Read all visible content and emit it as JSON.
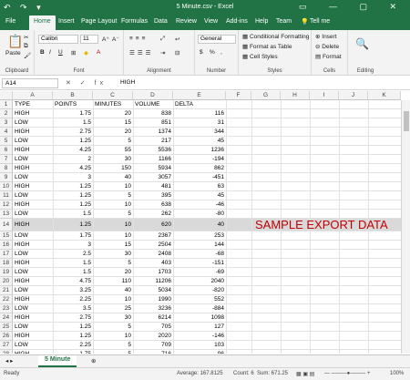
{
  "window": {
    "title": "5 Minute.csv - Excel",
    "quick_access": "↶ ↷ ▾",
    "controls": "▭ — ▢ ✕"
  },
  "tabs": [
    "File",
    "Home",
    "Insert",
    "Page Layout",
    "Formulas",
    "Data",
    "Review",
    "View",
    "Add-ins",
    "Help",
    "Team",
    "Tell me"
  ],
  "ribbon": {
    "clipboard": {
      "label": "Clipboard",
      "paste": "Paste"
    },
    "font": {
      "label": "Font",
      "name": "Calibri",
      "size": "11",
      "grow": "A⁺",
      "shrink": "A⁻",
      "bold": "B",
      "italic": "I",
      "underline": "U"
    },
    "alignment": {
      "label": "Alignment"
    },
    "number": {
      "label": "Number",
      "format": "General",
      "currency": "$",
      "percent": "%",
      "comma": ","
    },
    "styles": {
      "label": "Styles",
      "conditional": "Conditional Formatting",
      "table": "Format as Table",
      "cellstyles": "Cell Styles"
    },
    "cells": {
      "label": "Cells",
      "insert": "Insert",
      "delete": "Delete",
      "format": "Format"
    },
    "editing": {
      "label": "Editing"
    }
  },
  "formula_bar": {
    "name_box": "A14",
    "fx": "✕ ✓ fx",
    "value": "HIGH"
  },
  "columns": [
    "A",
    "B",
    "C",
    "D",
    "E",
    "F",
    "G",
    "H",
    "I",
    "J",
    "K"
  ],
  "rows": [
    {
      "n": "1",
      "type": "TYPE",
      "points": "POINTS",
      "minutes": "MINUTES",
      "volume": "VOLUME",
      "delta": "DELTA"
    },
    {
      "n": "2",
      "type": "HIGH",
      "points": "1.75",
      "minutes": "20",
      "volume": "838",
      "delta": "116"
    },
    {
      "n": "3",
      "type": "LOW",
      "points": "1.5",
      "minutes": "15",
      "volume": "851",
      "delta": "31"
    },
    {
      "n": "4",
      "type": "HIGH",
      "points": "2.75",
      "minutes": "20",
      "volume": "1374",
      "delta": "344"
    },
    {
      "n": "5",
      "type": "LOW",
      "points": "1.25",
      "minutes": "5",
      "volume": "217",
      "delta": "45"
    },
    {
      "n": "6",
      "type": "HIGH",
      "points": "4.25",
      "minutes": "55",
      "volume": "5536",
      "delta": "1236"
    },
    {
      "n": "7",
      "type": "LOW",
      "points": "2",
      "minutes": "30",
      "volume": "1166",
      "delta": "-194"
    },
    {
      "n": "8",
      "type": "HIGH",
      "points": "4.25",
      "minutes": "150",
      "volume": "5934",
      "delta": "862"
    },
    {
      "n": "9",
      "type": "LOW",
      "points": "3",
      "minutes": "40",
      "volume": "3057",
      "delta": "-451"
    },
    {
      "n": "10",
      "type": "HIGH",
      "points": "1.25",
      "minutes": "10",
      "volume": "481",
      "delta": "63"
    },
    {
      "n": "11",
      "type": "LOW",
      "points": "1.25",
      "minutes": "5",
      "volume": "395",
      "delta": "45"
    },
    {
      "n": "12",
      "type": "HIGH",
      "points": "1.25",
      "minutes": "10",
      "volume": "638",
      "delta": "-46"
    },
    {
      "n": "13",
      "type": "LOW",
      "points": "1.5",
      "minutes": "5",
      "volume": "262",
      "delta": "-80"
    },
    {
      "n": "14",
      "type": "HIGH",
      "points": "1.25",
      "minutes": "10",
      "volume": "620",
      "delta": "40"
    },
    {
      "n": "15",
      "type": "LOW",
      "points": "1.75",
      "minutes": "10",
      "volume": "2367",
      "delta": "253"
    },
    {
      "n": "16",
      "type": "HIGH",
      "points": "3",
      "minutes": "15",
      "volume": "2504",
      "delta": "144"
    },
    {
      "n": "17",
      "type": "LOW",
      "points": "2.5",
      "minutes": "30",
      "volume": "2408",
      "delta": "-68"
    },
    {
      "n": "18",
      "type": "HIGH",
      "points": "1.5",
      "minutes": "5",
      "volume": "403",
      "delta": "-151"
    },
    {
      "n": "19",
      "type": "LOW",
      "points": "1.5",
      "minutes": "20",
      "volume": "1703",
      "delta": "-69"
    },
    {
      "n": "20",
      "type": "HIGH",
      "points": "4.75",
      "minutes": "110",
      "volume": "11206",
      "delta": "2040"
    },
    {
      "n": "21",
      "type": "LOW",
      "points": "3.25",
      "minutes": "40",
      "volume": "5034",
      "delta": "-820"
    },
    {
      "n": "22",
      "type": "HIGH",
      "points": "2.25",
      "minutes": "10",
      "volume": "1990",
      "delta": "552"
    },
    {
      "n": "23",
      "type": "LOW",
      "points": "3.5",
      "minutes": "25",
      "volume": "3236",
      "delta": "-884"
    },
    {
      "n": "24",
      "type": "HIGH",
      "points": "2.75",
      "minutes": "30",
      "volume": "6214",
      "delta": "1098"
    },
    {
      "n": "25",
      "type": "LOW",
      "points": "1.25",
      "minutes": "5",
      "volume": "705",
      "delta": "127"
    },
    {
      "n": "26",
      "type": "HIGH",
      "points": "1.25",
      "minutes": "10",
      "volume": "2020",
      "delta": "-146"
    },
    {
      "n": "27",
      "type": "LOW",
      "points": "2.25",
      "minutes": "5",
      "volume": "709",
      "delta": "103"
    },
    {
      "n": "28",
      "type": "HIGH",
      "points": "1.75",
      "minutes": "5",
      "volume": "716",
      "delta": "-96"
    }
  ],
  "overlay": {
    "text": "SAMPLE EXPORT DATA",
    "color": "#c00000"
  },
  "sheet_tab": "5 Minute",
  "status": {
    "ready": "Ready",
    "average": "Average: 167.8125",
    "count": "Count: 6",
    "sum": "Sum: 671.25",
    "zoom": "100%"
  },
  "accent": "#217346"
}
